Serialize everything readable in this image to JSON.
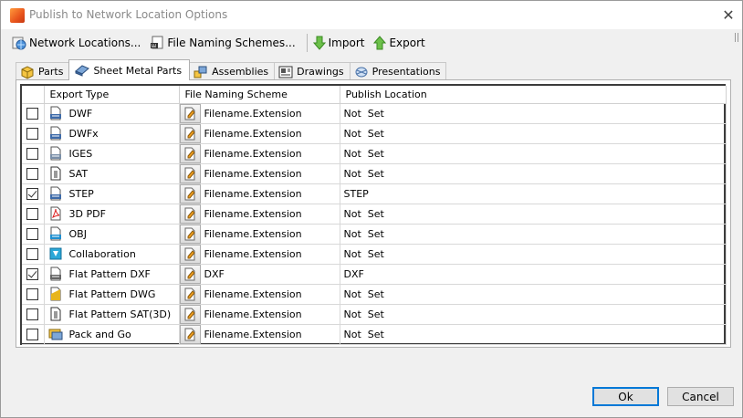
{
  "window": {
    "title": "Publish to Network Location Options",
    "close_glyph": "✕"
  },
  "toolbar": {
    "network_locations": "Network Locations...",
    "file_naming_schemes": "File Naming Schemes...",
    "import": "Import",
    "export": "Export"
  },
  "tabs": [
    {
      "label": "Parts",
      "icon": "cube-icon",
      "active": false
    },
    {
      "label": "Sheet Metal Parts",
      "icon": "sheet-metal-icon",
      "active": true
    },
    {
      "label": "Assemblies",
      "icon": "assembly-icon",
      "active": false
    },
    {
      "label": "Drawings",
      "icon": "drawing-icon",
      "active": false
    },
    {
      "label": "Presentations",
      "icon": "presentation-icon",
      "active": false
    }
  ],
  "grid": {
    "columns": [
      "Export Type",
      "File Naming Scheme",
      "Publish Location"
    ],
    "rows": [
      {
        "checked": false,
        "type": "DWF",
        "icon": "dwf-file-icon",
        "scheme": "Filename.Extension",
        "location": "Not  Set"
      },
      {
        "checked": false,
        "type": "DWFx",
        "icon": "dwfx-file-icon",
        "scheme": "Filename.Extension",
        "location": "Not  Set"
      },
      {
        "checked": false,
        "type": "IGES",
        "icon": "iges-file-icon",
        "scheme": "Filename.Extension",
        "location": "Not  Set"
      },
      {
        "checked": false,
        "type": "SAT",
        "icon": "sat-file-icon",
        "scheme": "Filename.Extension",
        "location": "Not  Set"
      },
      {
        "checked": true,
        "type": "STEP",
        "icon": "step-file-icon",
        "scheme": "Filename.Extension",
        "location": "STEP"
      },
      {
        "checked": false,
        "type": "3D PDF",
        "icon": "pdf-file-icon",
        "scheme": "Filename.Extension",
        "location": "Not  Set"
      },
      {
        "checked": false,
        "type": "OBJ",
        "icon": "obj-file-icon",
        "scheme": "Filename.Extension",
        "location": "Not  Set"
      },
      {
        "checked": false,
        "type": "Collaboration",
        "icon": "collaboration-icon",
        "scheme": "Filename.Extension",
        "location": "Not  Set"
      },
      {
        "checked": true,
        "type": "Flat Pattern DXF",
        "icon": "dxf-file-icon",
        "scheme": "DXF",
        "location": "DXF"
      },
      {
        "checked": false,
        "type": "Flat Pattern DWG",
        "icon": "dwg-file-icon",
        "scheme": "Filename.Extension",
        "location": "Not  Set"
      },
      {
        "checked": false,
        "type": "Flat Pattern SAT(3D)",
        "icon": "sat-file-icon",
        "scheme": "Filename.Extension",
        "location": "Not  Set"
      },
      {
        "checked": false,
        "type": "Pack and Go",
        "icon": "pack-and-go-icon",
        "scheme": "Filename.Extension",
        "location": "Not  Set"
      }
    ]
  },
  "buttons": {
    "ok": "Ok",
    "cancel": "Cancel"
  }
}
